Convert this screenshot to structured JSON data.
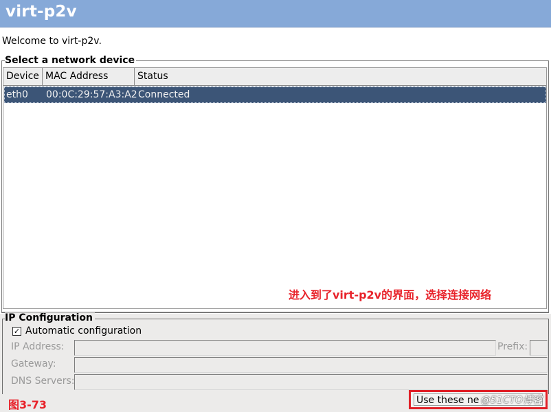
{
  "window": {
    "title": "virt-p2v"
  },
  "welcome_text": "Welcome to virt-p2v.",
  "network": {
    "frame_label": "Select a network device",
    "columns": [
      "Device",
      "MAC Address",
      "Status"
    ],
    "rows": [
      {
        "device": "eth0",
        "mac": "00:0C:29:57:A3:A2",
        "status": "Connected"
      }
    ]
  },
  "annotation_text": "进入到了virt-p2v的界面，选择连接网络",
  "ip_config": {
    "frame_label": "IP Configuration",
    "auto_label": "Automatic configuration",
    "auto_checked": true,
    "check_glyph": "✓",
    "ip_label": "IP Address:",
    "ip_value": "",
    "prefix_label": "Prefix:",
    "prefix_value": "",
    "gateway_label": "Gateway:",
    "gateway_value": "",
    "dns_label": "DNS Servers:",
    "dns_value": ""
  },
  "figure_label": "图3-73",
  "action_button_label": "Use these ne",
  "watermark_text": "@51CTO博客",
  "colors": {
    "titlebar": "#86a9d8",
    "selection": "#3c5577",
    "annotation": "#e8232b",
    "highlight_box": "#e01f26"
  }
}
